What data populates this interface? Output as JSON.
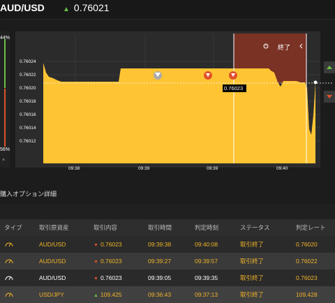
{
  "header": {
    "pair": "AUD/USD",
    "price": "0.76021",
    "trend_icon": "up-arrow-icon"
  },
  "left_panel": {
    "top_pct": "44%",
    "bottom_pct": "56%",
    "close": "×"
  },
  "chart": {
    "expiry_label": "終了",
    "current_price_label": "0.76023",
    "colors": {
      "area": "#ffc433",
      "expiry_zone": "#7a3225",
      "call": "#6abf45",
      "put": "#e0522b"
    }
  },
  "chart_data": {
    "type": "area",
    "y_ticks": [
      "0.76024",
      "0.76022",
      "0.76020",
      "0.76018",
      "0.76016",
      "0.76014",
      "0.76012"
    ],
    "x_ticks": [
      "09:38",
      "09:39",
      "09:39",
      "09:40"
    ],
    "ylim": [
      0.7601,
      0.76025
    ],
    "series": [
      {
        "values": [
          0.76024,
          0.76022,
          0.7602,
          0.7602,
          0.7602,
          0.76022,
          0.76022,
          0.76022,
          0.76022,
          0.76022,
          0.76023,
          0.76023,
          0.76023,
          0.76022,
          0.76019,
          0.76021,
          0.7602,
          0.76021,
          0.76014,
          0.76021
        ]
      }
    ],
    "grid": true
  },
  "section_title": "購入オプション詳細",
  "table": {
    "headers": [
      "タイプ",
      "取引原資産",
      "取引内容",
      "取引時間",
      "判定時刻",
      "ステータス",
      "判定レート"
    ],
    "rows": [
      {
        "asset": "AUD/USD",
        "rate": "0.76023",
        "time": "09:39:38",
        "judge": "09:40:08",
        "status": "取引終了",
        "final": "0.76020"
      },
      {
        "asset": "AUD/USD",
        "rate": "0.76023",
        "time": "09:39:27",
        "judge": "09:39:57",
        "status": "取引終了",
        "final": "0.76022"
      },
      {
        "asset": "AUD/USD",
        "rate": "0.76023",
        "time": "09:39:05",
        "judge": "09:39:35",
        "status": "取引終了",
        "final": "0.76023"
      },
      {
        "asset": "USD/JPY",
        "rate": "109.425",
        "time": "09:36:43",
        "judge": "09:37:13",
        "status": "取引終了",
        "final": "109.428"
      }
    ]
  }
}
